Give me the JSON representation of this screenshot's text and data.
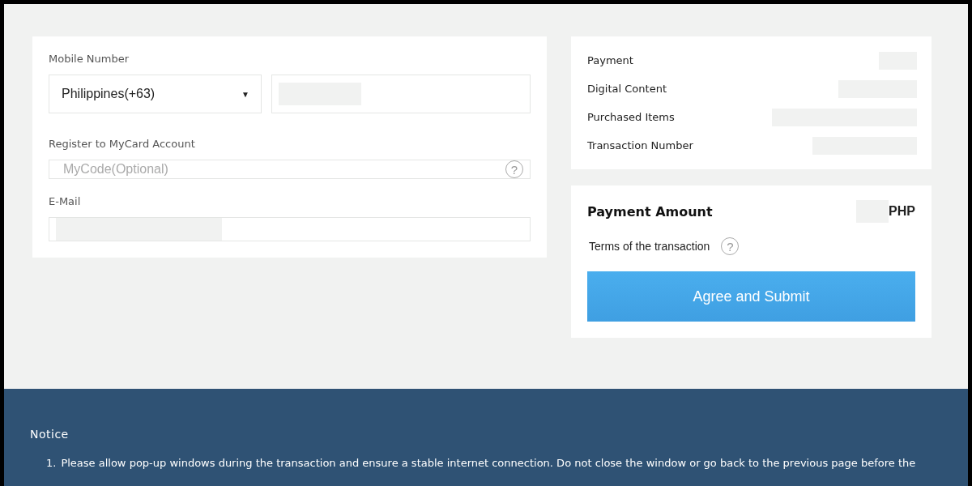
{
  "form": {
    "mobile_label": "Mobile Number",
    "country_select": {
      "value": "Philippines(+63)",
      "caret": "▼"
    },
    "register_label": "Register to MyCard Account",
    "mycode_field": {
      "placeholder": "MyCode(Optional)"
    },
    "help_mark": "?",
    "email_label": "E-Mail"
  },
  "summary": {
    "rows": [
      {
        "label": "Payment"
      },
      {
        "label": "Digital Content"
      },
      {
        "label": "Purchased Items"
      },
      {
        "label": "Transaction Number"
      }
    ]
  },
  "amount": {
    "label": "Payment Amount",
    "currency": "PHP",
    "terms": "Terms of the transaction",
    "help_mark": "?",
    "submit": "Agree and Submit"
  },
  "notice": {
    "title": "Notice",
    "items": [
      {
        "number": "1.",
        "text": "Please allow pop-up windows during the transaction and ensure a stable internet connection. Do not close the window or go back to the previous page before the"
      }
    ]
  }
}
